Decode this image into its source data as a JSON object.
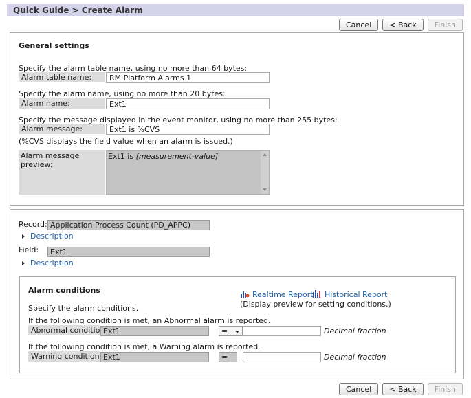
{
  "breadcrumb": "Quick Guide > Create Alarm",
  "buttons": {
    "cancel": "Cancel",
    "back": "< Back",
    "finish": "Finish"
  },
  "general": {
    "title": "General settings",
    "table_instr": "Specify the alarm table name, using no more than 64 bytes:",
    "table_label": "Alarm table name:",
    "table_value": "RM Platform Alarms 1",
    "name_instr": "Specify the alarm name, using no more than 20 bytes:",
    "name_label": "Alarm name:",
    "name_value": "Ext1",
    "msg_instr": "Specify the message displayed in the event monitor, using no more than 255 bytes:",
    "msg_label": "Alarm message:",
    "msg_value": "Ext1 is %CVS",
    "msg_hint": "(%CVS displays the field value when an alarm is issued.)",
    "preview_label": "Alarm message preview:",
    "preview_prefix": "Ext1 is ",
    "preview_italic": "[measurement-value]"
  },
  "record": {
    "record_label": "Record:",
    "record_value": "Application Process Count (PD_APPC)",
    "description": "Description",
    "field_label": "Field:",
    "field_value": "Ext1"
  },
  "conditions": {
    "title": "Alarm conditions",
    "realtime": "Realtime Report",
    "historical": "Historical Report",
    "preview_note": "(Display preview for setting conditions.)",
    "instr": "Specify the alarm conditions.",
    "abnormal_instr": "If the following condition is met, an Abnormal alarm is reported.",
    "abnormal_label": "Abnormal condition:",
    "abnormal_field": "Ext1",
    "abnormal_op": "=",
    "abnormal_value": "",
    "warning_instr": "If the following condition is met, a Warning alarm is reported.",
    "warning_label": "Warning condition:",
    "warning_field": "Ext1",
    "warning_op": "=",
    "warning_value": "",
    "type_hint": "Decimal fraction"
  },
  "icons": {
    "realtime": "realtime-report-icon",
    "historical": "historical-report-icon"
  }
}
